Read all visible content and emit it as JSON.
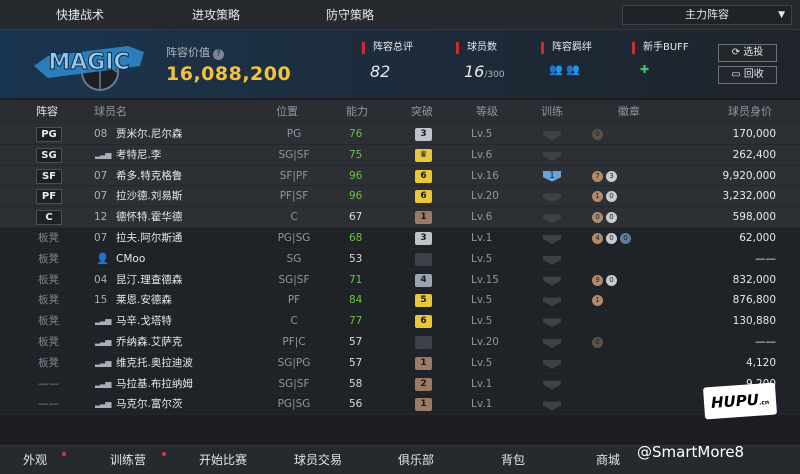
{
  "tabs": [
    {
      "label": "快捷战术"
    },
    {
      "label": "进攻策略"
    },
    {
      "label": "防守策略"
    }
  ],
  "lineup_select": {
    "value": "主力阵容"
  },
  "header": {
    "logo_text": "MAGIC",
    "value_label": "阵容价值",
    "value": "16,088,200",
    "stats": {
      "overall_label": "阵容总评",
      "overall_value": "82",
      "players_label": "球员数",
      "players_value": "16",
      "players_max": "/300",
      "bond_label": "阵容羁绊",
      "buff_label": "新手BUFF"
    },
    "buttons": {
      "select": "选投",
      "recycle": "回收"
    }
  },
  "columns": [
    "阵容",
    "球员名",
    "位置",
    "能力",
    "突破",
    "等级",
    "训练",
    "徽章",
    "球员身价"
  ],
  "players": [
    {
      "role": "PG",
      "num": "08",
      "name": "贾米尔.尼尔森",
      "pos": "PG",
      "ability": "76",
      "ab_color": "green",
      "brk": "3",
      "brk_color": "#bfc4ca",
      "level": "Lv.5",
      "train": "",
      "badges": [
        "0"
      ],
      "badge_colors": [
        "#5a5147"
      ],
      "value": "170,000"
    },
    {
      "role": "SG",
      "num": "",
      "name": "考特尼.李",
      "pos": "SG|SF",
      "ability": "75",
      "ab_color": "green",
      "brk": "♛",
      "brk_color": "#e8c83a",
      "level": "Lv.6",
      "train": "",
      "badges": [],
      "badge_colors": [],
      "value": "262,400"
    },
    {
      "role": "SF",
      "num": "07",
      "name": "希多.特克格鲁",
      "pos": "SF|PF",
      "ability": "96",
      "ab_color": "green",
      "brk": "6",
      "brk_color": "#e8c83a",
      "level": "Lv.16",
      "train": "1",
      "badges": [
        "7",
        "3"
      ],
      "badge_colors": [
        "#b08a6e",
        "#c7ccd2"
      ],
      "value": "9,920,000"
    },
    {
      "role": "PF",
      "num": "07",
      "name": "拉沙德.刘易斯",
      "pos": "PF|SF",
      "ability": "96",
      "ab_color": "green",
      "brk": "6",
      "brk_color": "#e8c83a",
      "level": "Lv.20",
      "train": "",
      "badges": [
        "1",
        "0"
      ],
      "badge_colors": [
        "#b08a6e",
        "#c7ccd2"
      ],
      "value": "3,232,000"
    },
    {
      "role": "C",
      "num": "12",
      "name": "德怀特.霍华德",
      "pos": "C",
      "ability": "67",
      "ab_color": "white",
      "brk": "1",
      "brk_color": "#9c7b66",
      "level": "Lv.6",
      "train": "",
      "badges": [
        "0",
        "0"
      ],
      "badge_colors": [
        "#b08a6e",
        "#c7ccd2"
      ],
      "value": "598,000"
    },
    {
      "role": "板凳",
      "num": "07",
      "name": "拉夫.阿尔斯通",
      "pos": "PG|SG",
      "ability": "68",
      "ab_color": "green",
      "brk": "3",
      "brk_color": "#bfc4ca",
      "level": "Lv.1",
      "train": "",
      "badges": [
        "4",
        "0",
        "0"
      ],
      "badge_colors": [
        "#b08a6e",
        "#c7ccd2",
        "#5d7d9e"
      ],
      "value": "62,000"
    },
    {
      "role": "板凳",
      "num": "",
      "name": "CMoo",
      "pos": "SG",
      "ability": "53",
      "ab_color": "white",
      "brk": "",
      "brk_color": "#3d4248",
      "level": "Lv.5",
      "train": "",
      "badges": [],
      "badge_colors": [],
      "value": "——"
    },
    {
      "role": "板凳",
      "num": "04",
      "name": "昆汀.理查德森",
      "pos": "SG|SF",
      "ability": "71",
      "ab_color": "green",
      "brk": "4",
      "brk_color": "#9aa5b1",
      "level": "Lv.15",
      "train": "",
      "badges": [
        "9",
        "0"
      ],
      "badge_colors": [
        "#b08a6e",
        "#c7ccd2"
      ],
      "value": "832,000"
    },
    {
      "role": "板凳",
      "num": "15",
      "name": "莱恩.安德森",
      "pos": "PF",
      "ability": "84",
      "ab_color": "green",
      "brk": "5",
      "brk_color": "#e8c83a",
      "level": "Lv.5",
      "train": "",
      "badges": [
        "1"
      ],
      "badge_colors": [
        "#b08a6e"
      ],
      "value": "876,800"
    },
    {
      "role": "板凳",
      "num": "",
      "name": "马辛.戈塔特",
      "pos": "C",
      "ability": "77",
      "ab_color": "green",
      "brk": "6",
      "brk_color": "#e8c83a",
      "level": "Lv.5",
      "train": "",
      "badges": [],
      "badge_colors": [],
      "value": "130,880"
    },
    {
      "role": "板凳",
      "num": "",
      "name": "乔纳森.艾萨克",
      "pos": "PF|C",
      "ability": "57",
      "ab_color": "white",
      "brk": "",
      "brk_color": "#3d4248",
      "level": "Lv.20",
      "train": "",
      "badges": [
        "0"
      ],
      "badge_colors": [
        "#5a5147"
      ],
      "value": "——"
    },
    {
      "role": "板凳",
      "num": "",
      "name": "维克托.奥拉迪波",
      "pos": "SG|PG",
      "ability": "57",
      "ab_color": "white",
      "brk": "1",
      "brk_color": "#9c7b66",
      "level": "Lv.5",
      "train": "",
      "badges": [],
      "badge_colors": [],
      "value": "4,120"
    },
    {
      "role": "——",
      "num": "",
      "name": "马拉基.布拉纳姆",
      "pos": "SG|SF",
      "ability": "58",
      "ab_color": "white",
      "brk": "2",
      "brk_color": "#9c7b66",
      "level": "Lv.1",
      "train": "",
      "badges": [],
      "badge_colors": [],
      "value": "9,200"
    },
    {
      "role": "——",
      "num": "",
      "name": "马克尔.富尔茨",
      "pos": "PG|SG",
      "ability": "56",
      "ab_color": "white",
      "brk": "1",
      "brk_color": "#9c7b66",
      "level": "Lv.1",
      "train": "",
      "badges": [],
      "badge_colors": [],
      "value": ""
    }
  ],
  "bottom_nav": [
    {
      "label": "外观"
    },
    {
      "label": "训练营"
    },
    {
      "label": "开始比赛"
    },
    {
      "label": "球员交易"
    },
    {
      "label": "俱乐部"
    },
    {
      "label": "背包"
    },
    {
      "label": "商城"
    }
  ],
  "watermark": "@SmartMore8",
  "hupu_logo": "HUPU"
}
